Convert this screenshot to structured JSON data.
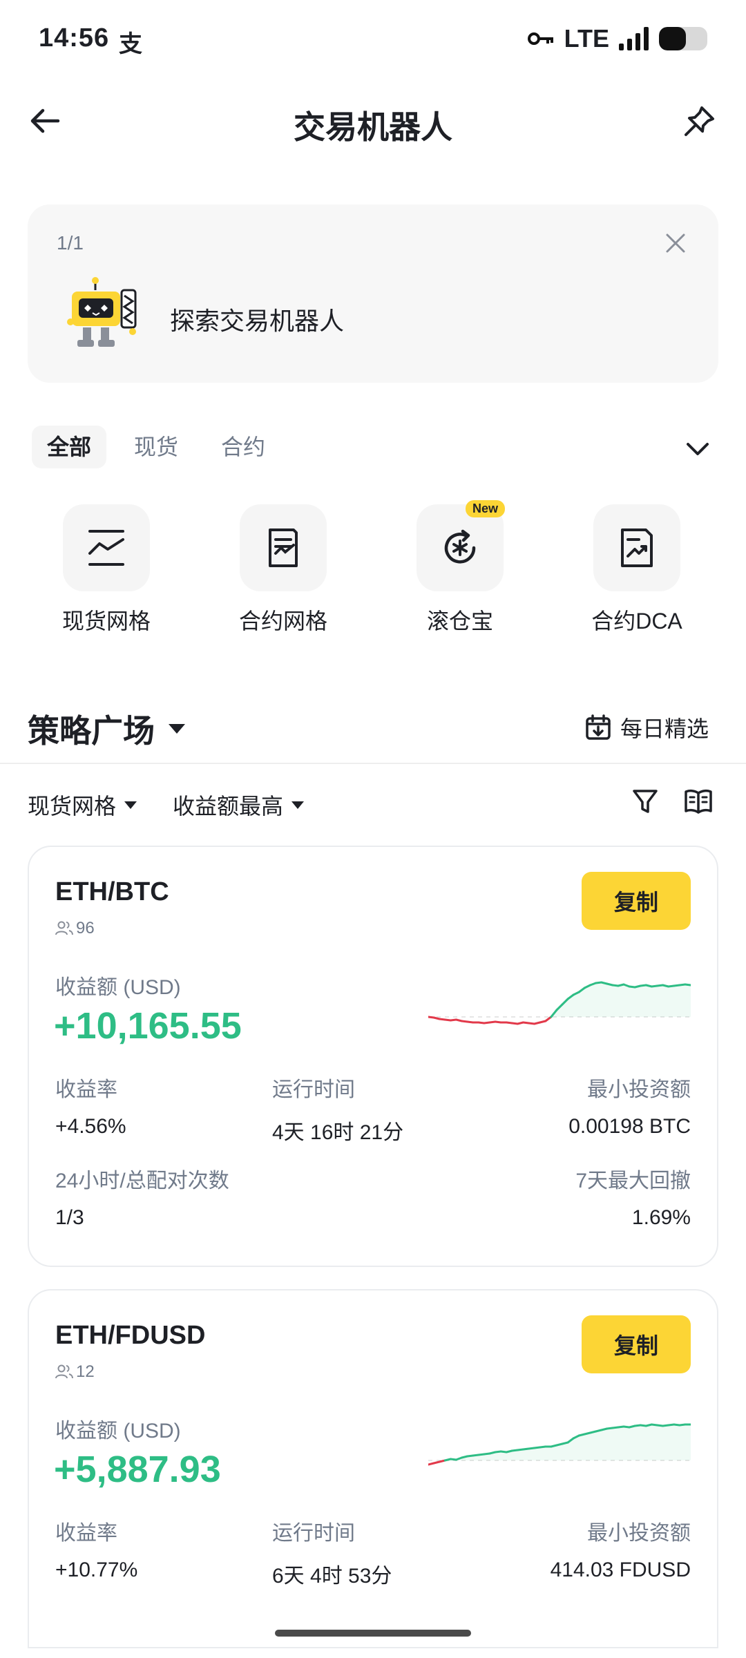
{
  "status_bar": {
    "time": "14:56",
    "app_glyph": "支",
    "network": "LTE",
    "battery_level": 0.55
  },
  "header": {
    "title": "交易机器人"
  },
  "banner": {
    "counter": "1/1",
    "text": "探索交易机器人"
  },
  "tabs": [
    {
      "label": "全部",
      "active": true
    },
    {
      "label": "现货",
      "active": false
    },
    {
      "label": "合约",
      "active": false
    }
  ],
  "bots": [
    {
      "label": "现货网格",
      "icon": "spot-grid-icon"
    },
    {
      "label": "合约网格",
      "icon": "futures-grid-icon"
    },
    {
      "label": "滚仓宝",
      "icon": "rolling-position-icon",
      "badge": "New"
    },
    {
      "label": "合约DCA",
      "icon": "futures-dca-icon"
    }
  ],
  "strategy": {
    "title": "策略广场",
    "daily_pick": "每日精选"
  },
  "filters": {
    "type": "现货网格",
    "sort": "收益额最高"
  },
  "cards": [
    {
      "pair": "ETH/BTC",
      "copiers": "96",
      "copy_label": "复制",
      "pnl_label": "收益额 (USD)",
      "pnl_value": "+10,165.55",
      "roi_label": "收益率",
      "roi": "+4.56%",
      "runtime_label": "运行时间",
      "runtime": "4天 16时 21分",
      "min_invest_label": "最小投资额",
      "min_invest": "0.00198 BTC",
      "matches_label": "24小时/总配对次数",
      "matches": "1/3",
      "drawdown_label": "7天最大回撤",
      "drawdown": "1.69%",
      "spark_color_neg": "#e2394a",
      "spark_color_pos": "#2ebd85"
    },
    {
      "pair": "ETH/FDUSD",
      "copiers": "12",
      "copy_label": "复制",
      "pnl_label": "收益额 (USD)",
      "pnl_value": "+5,887.93",
      "roi_label": "收益率",
      "roi": "+10.77%",
      "runtime_label": "运行时间",
      "runtime": "6天 4时 53分",
      "min_invest_label": "最小投资额",
      "min_invest": "414.03 FDUSD",
      "spark_color_neg": "#e2394a",
      "spark_color_pos": "#2ebd85"
    }
  ],
  "colors": {
    "accent": "#fcd535",
    "profit": "#2ebd85",
    "loss": "#e2394a"
  }
}
